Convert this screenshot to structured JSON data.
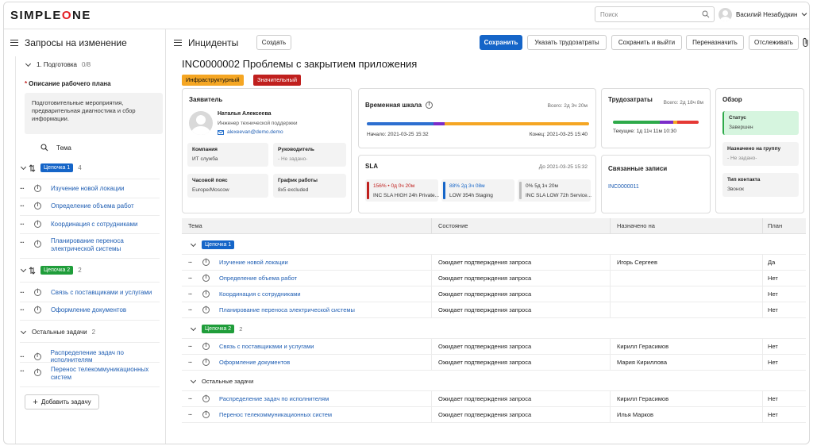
{
  "app": {
    "logo_left": "SIMPLE",
    "logo_o": "O",
    "logo_right": "NE"
  },
  "search": {
    "placeholder": "Поиск"
  },
  "user": {
    "name": "Василий Незабудкин"
  },
  "left": {
    "title": "Запросы на изменение",
    "stage": {
      "label": "1. Подготовка",
      "count": "0/8"
    },
    "plan_label": "Описание рабочего плана",
    "plan_text": "Подготовительные мероприятия, предварительная диагностика и сбор информации.",
    "col_header": "Тема",
    "chains": [
      {
        "tag": "Цепочка 1",
        "color": "#1565c8",
        "count": "4",
        "items": [
          "Изучение новой локации",
          "Определение объема работ",
          "Координация с сотрудниками",
          "Планирование переноса электрической системы"
        ]
      },
      {
        "tag": "Цепочка 2",
        "color": "#1f9d3a",
        "count": "2",
        "items": [
          "Связь с поставщиками и услугами",
          "Оформление документов"
        ]
      }
    ],
    "other": {
      "label": "Остальные задачи",
      "count": "2",
      "items": [
        "Распределение задач по исполнителям",
        "Перенос телекоммуникационных систем"
      ]
    },
    "add_task": "Добавить задачу"
  },
  "main": {
    "title": "Инциденты",
    "create": "Создать",
    "buttons": {
      "save": "Сохранить",
      "effort": "Указать трудозатраты",
      "save_exit": "Сохранить и выйти",
      "reassign": "Переназначить",
      "track": "Отслеживать"
    },
    "record_title": "INC0000002 Проблемы с закрытием приложения",
    "badges": [
      {
        "text": "Инфраструктурный",
        "color": "#f5a623"
      },
      {
        "text": "Значительный",
        "color": "#c0201e",
        "text_color": "#ffffff"
      }
    ]
  },
  "requester": {
    "title": "Заявитель",
    "name": "Наталья Алексеева",
    "position": "Инженер технической поддержки",
    "email": "alexeevan@demo.demo",
    "fields": [
      {
        "label": "Компания",
        "value": "ИТ служба"
      },
      {
        "label": "Руководитель",
        "value": "- Не задано-"
      },
      {
        "label": "Часовой пояс",
        "value": "Europe/Moscow"
      },
      {
        "label": "График работы",
        "value": "8x5 excluded"
      }
    ]
  },
  "timeline": {
    "title": "Временная шкала",
    "total": "Всего: 2д 3ч 20м",
    "start": "Начало: 2021-03-25 15:32",
    "end": "Конец: 2021-03-25 15:40",
    "segments": [
      {
        "color": "#2d6fd0",
        "value": 0.3
      },
      {
        "color": "#7b2cc9",
        "value": 0.05
      },
      {
        "color": "#f5a623",
        "value": 0.65
      }
    ]
  },
  "effort": {
    "title": "Трудозатраты",
    "total": "Всего: 2д 18ч 8м",
    "current": "Текущие: 1д 11ч 11м 10:30",
    "segments": [
      {
        "color": "#2eaa4a",
        "value": 0.55
      },
      {
        "color": "#7b2cc9",
        "value": 0.15
      },
      {
        "color": "#f5a623",
        "value": 0.05
      },
      {
        "color": "#e53935",
        "value": 0.25
      }
    ]
  },
  "overview": {
    "title": "Обзор",
    "fields": [
      {
        "label": "Статус",
        "value": "Завершен",
        "highlight": true
      },
      {
        "label": "Назначено на группу",
        "value": "- Не задано-"
      },
      {
        "label": "Тип контакта",
        "value": "Звонок"
      }
    ]
  },
  "sla": {
    "title": "SLA",
    "until": "До 2021-03-25 15:32",
    "items": [
      {
        "value": "156% • 0д 0ч 20м",
        "name": "INC SLA HIGH 24h Private...",
        "color": "#c0201e"
      },
      {
        "value": "88% 2д 3ч 08м",
        "name": "LOW 354h Staging",
        "color": "#1565c8"
      },
      {
        "value": "0% 5д 1ч 20м",
        "name": "INC SLA LOW 72h Service...",
        "color": "#bdbdbd"
      }
    ]
  },
  "related": {
    "title": "Связанные записи",
    "link": "INC0000011"
  },
  "table": {
    "headers": [
      "Тема",
      "Состояние",
      "Назначено на",
      "План"
    ],
    "groups": [
      {
        "tag": "Цепочка 1",
        "color": "#1565c8",
        "count": "",
        "rows": [
          {
            "topic": "Изучение новой локации",
            "state": "Ожидает подтверждения запроса",
            "assignee": "Игорь Сергеев",
            "plan": "Да"
          },
          {
            "topic": "Определение объема работ",
            "state": "Ожидает подтверждения запроса",
            "assignee": "",
            "plan": "Нет"
          },
          {
            "topic": "Координация с сотрудниками",
            "state": "Ожидает подтверждения запроса",
            "assignee": "",
            "plan": "Нет"
          },
          {
            "topic": "Планирование переноса электрической системы",
            "state": "Ожидает подтверждения запроса",
            "assignee": "",
            "plan": "Нет"
          }
        ]
      },
      {
        "tag": "Цепочка 2",
        "color": "#1f9d3a",
        "count": "2",
        "rows": [
          {
            "topic": "Связь с поставщиками и услугами",
            "state": "Ожидает подтверждения запроса",
            "assignee": "Кирилл Герасимов",
            "plan": "Нет"
          },
          {
            "topic": "Оформление документов",
            "state": "Ожидает подтверждения запроса",
            "assignee": "Мария Кириллова",
            "plan": "Нет"
          }
        ]
      },
      {
        "label": "Остальные задачи",
        "rows": [
          {
            "topic": "Распределение задач по исполнителям",
            "state": "Ожидает подтверждения запроса",
            "assignee": "Кирилл Герасимов",
            "plan": "Нет"
          },
          {
            "topic": "Перенос телекоммуникационных систем",
            "state": "Ожидает подтверждения запроса",
            "assignee": "Илья Марков",
            "plan": "Нет"
          }
        ]
      }
    ]
  }
}
